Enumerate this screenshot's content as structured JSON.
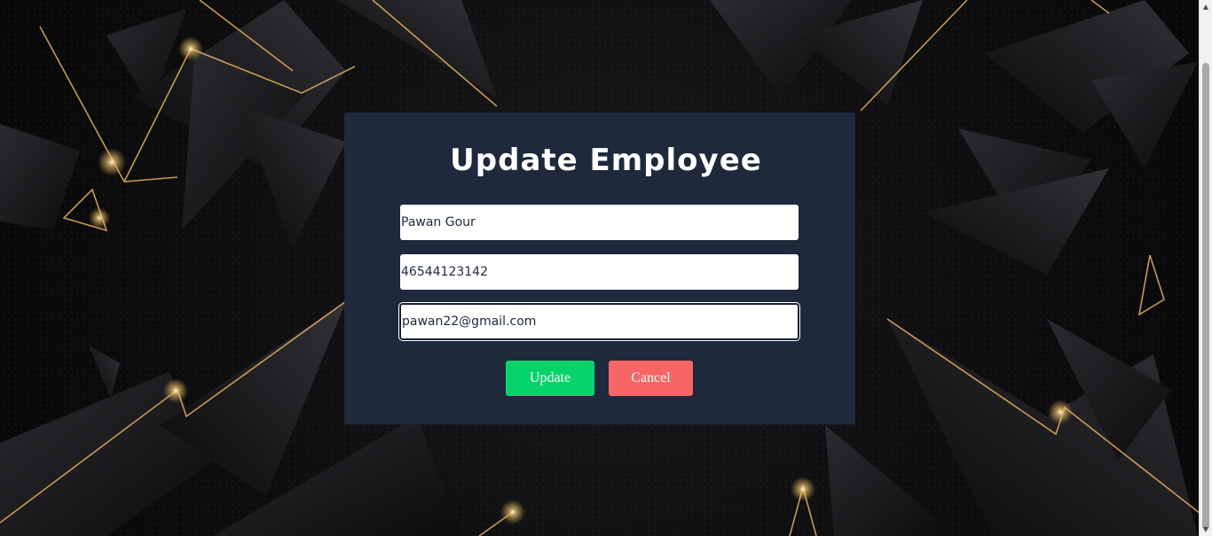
{
  "form": {
    "title": "Update Employee",
    "name_value": "Pawan Gour",
    "phone_value": "46544123142",
    "email_value": "pawan22@gmail.com",
    "update_label": "Update",
    "cancel_label": "Cancel"
  },
  "colors": {
    "card_background": "#1e293b",
    "update_button": "#06d46b",
    "cancel_button": "#f76565",
    "gold_accent": "#d9a95a"
  }
}
